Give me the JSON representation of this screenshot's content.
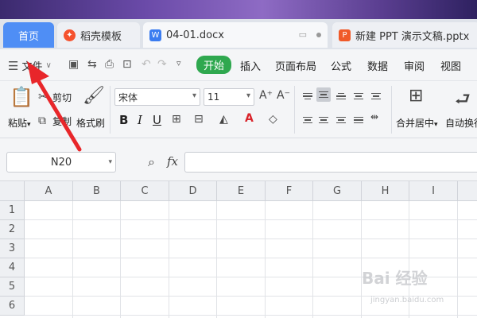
{
  "tabs": {
    "home": "首页",
    "items": [
      {
        "label": "稻壳模板",
        "icon": "daoke-icon"
      },
      {
        "label": "04-01.docx",
        "icon": "word-doc-icon"
      },
      {
        "label": "新建 PPT 演示文稿.pptx",
        "icon": "ppt-doc-icon"
      }
    ]
  },
  "menu": {
    "file": "文件",
    "tabs": [
      "开始",
      "插入",
      "页面布局",
      "公式",
      "数据",
      "审阅",
      "视图"
    ],
    "active_color": "#2fa84f"
  },
  "ribbon": {
    "paste": "粘贴",
    "cut": "剪切",
    "copy": "复制",
    "format_painter": "格式刷",
    "font_name": "宋体",
    "font_size": "11",
    "bold": "B",
    "italic": "I",
    "underline": "U",
    "merge_center": "合并居中",
    "auto_wrap": "自动换行"
  },
  "formula_bar": {
    "name_box": "N20",
    "fx": "fx",
    "formula": ""
  },
  "grid": {
    "columns": [
      "A",
      "B",
      "C",
      "D",
      "E",
      "F",
      "G",
      "H",
      "I"
    ],
    "rows": [
      "1",
      "2",
      "3",
      "4",
      "5",
      "6"
    ]
  },
  "watermark": {
    "text": "Bai 经验",
    "url": "jingyan.baidu.com"
  },
  "colors": {
    "home_tab": "#4f8ef5",
    "annotation_arrow": "#e8262a"
  }
}
